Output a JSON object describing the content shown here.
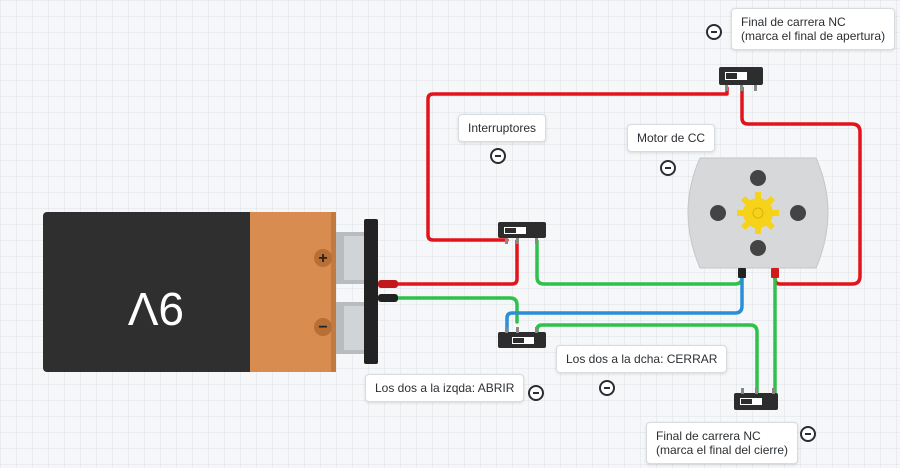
{
  "battery": {
    "label": "9V",
    "plus_symbol": "+",
    "minus_symbol": "−"
  },
  "notes": {
    "interruptores": "Interruptores",
    "motor": "Motor de CC",
    "nc_top_line1": "Final de carrera NC",
    "nc_top_line2": "(marca el final de apertura)",
    "abrir": "Los dos a la izqda: ABRIR",
    "cerrar": "Los dos a la dcha: CERRAR",
    "nc_bottom_line1": "Final de carrera NC",
    "nc_bottom_line2": "(marca el final del cierre)"
  },
  "colors": {
    "wire_red": "#e3131b",
    "wire_green": "#2fc14a",
    "wire_blue": "#2b8fd6",
    "battery_black": "#2f2f2f",
    "battery_orange": "#d88c4f",
    "motor_body": "#d6d8da",
    "gear": "#f6d21b"
  }
}
